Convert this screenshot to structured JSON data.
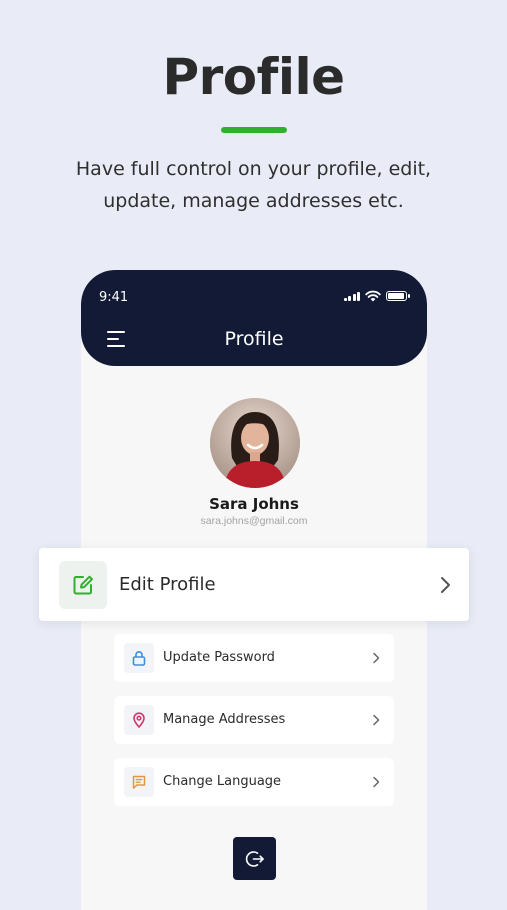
{
  "promo": {
    "headline": "Profile",
    "subtitle_line1": "Have full control on your profile, edit,",
    "subtitle_line2": "update, manage addresses etc."
  },
  "status_bar": {
    "time": "9:41"
  },
  "app_header": {
    "title": "Profile"
  },
  "user": {
    "name": "Sara Johns",
    "email": "sara.johns@gmail.com"
  },
  "menu": {
    "edit_profile": "Edit Profile",
    "items": [
      {
        "label": "Update Password",
        "icon": "lock-icon"
      },
      {
        "label": "Manage Addresses",
        "icon": "location-pin-icon"
      },
      {
        "label": "Change Language",
        "icon": "chat-icon"
      }
    ]
  },
  "colors": {
    "background": "#e9ecf6",
    "header": "#121a36",
    "accent": "#2fb02f",
    "lock": "#3d8ee0",
    "pin": "#d8346a",
    "chat": "#e2983a"
  }
}
